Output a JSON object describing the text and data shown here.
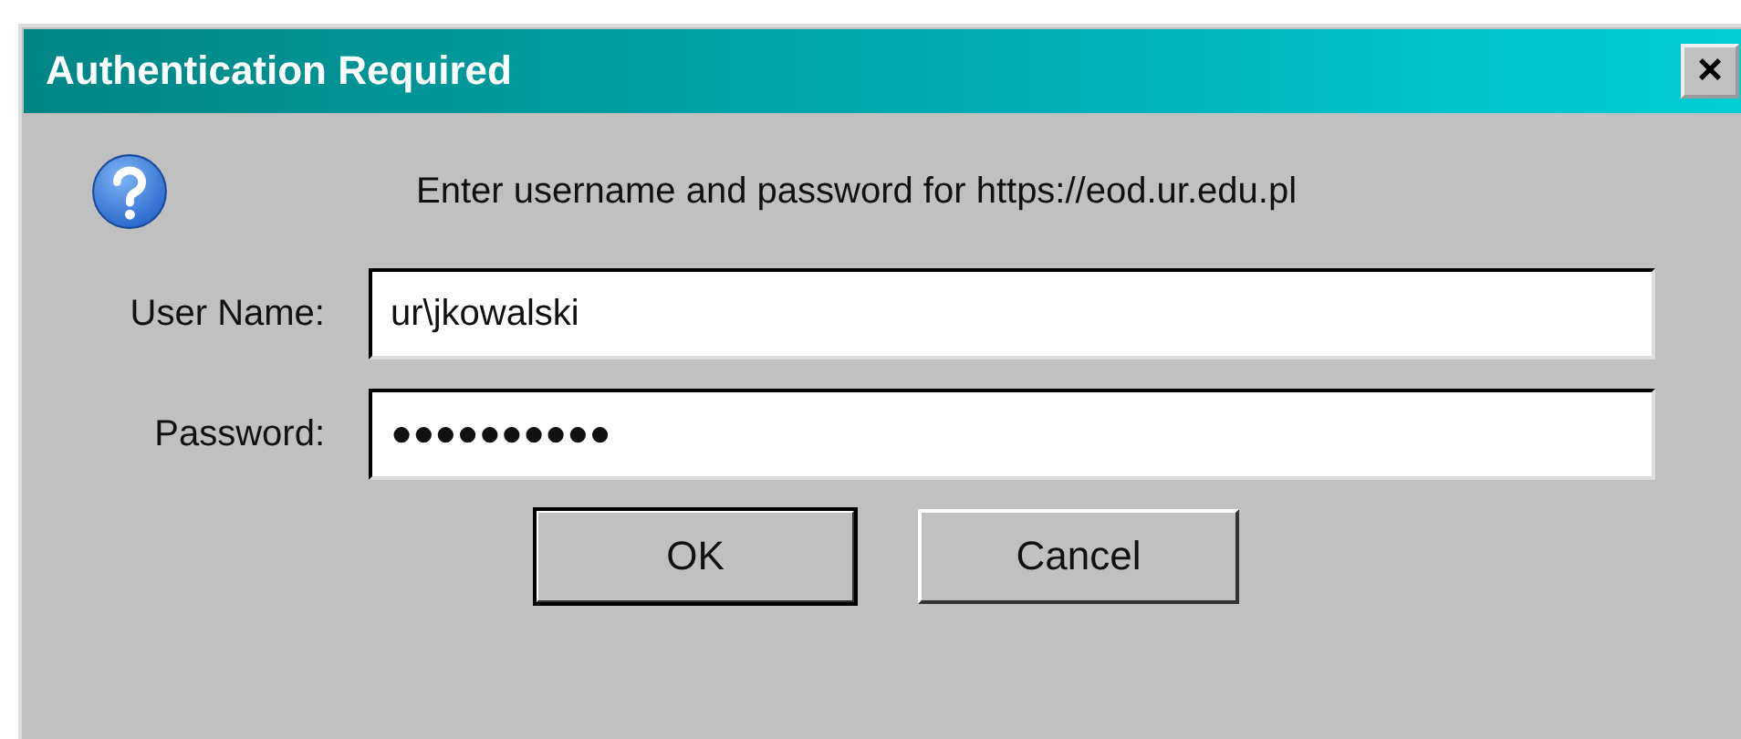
{
  "window": {
    "title": "Authentication Required",
    "close": "×"
  },
  "message": "Enter username and password for https://eod.ur.edu.pl",
  "fields": [
    {
      "label": "User Name:",
      "value": "ur\\jkowalski"
    },
    {
      "label": "Password:",
      "value": "●●●●●●●●●●"
    }
  ],
  "buttons": [
    {
      "label": "OK",
      "default": true
    },
    {
      "label": "Cancel",
      "default": false
    }
  ]
}
